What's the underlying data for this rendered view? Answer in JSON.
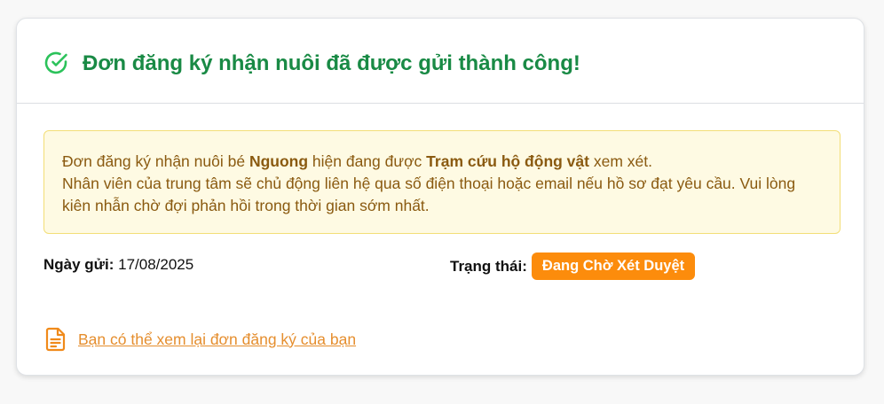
{
  "header": {
    "title": "Đơn đăng ký nhận nuôi đã được gửi thành công!",
    "icon": "check-circle-icon",
    "accent_color": "#198a45"
  },
  "notice": {
    "line1_prefix": "Đơn đăng ký nhận nuôi bé ",
    "pet_name": "Nguong",
    "line1_middle": " hiện đang được ",
    "center_name": "Trạm cứu hộ động vật",
    "line1_suffix": " xem xét.",
    "line2": "Nhân viên của trung tâm sẽ chủ động liên hệ qua số điện thoại hoặc email nếu hồ sơ đạt yêu cầu. Vui lòng kiên nhẫn chờ đợi phản hồi trong thời gian sớm nhất.",
    "background_color": "#fefae3",
    "text_color": "#8a5a10"
  },
  "meta": {
    "date_label": "Ngày gửi:",
    "date_value": "17/08/2025",
    "status_label": "Trạng thái:",
    "status_value": "Đang Chờ Xét Duyệt",
    "status_color": "#fc8c0c"
  },
  "link": {
    "icon": "document-icon",
    "text": "Bạn có thể xem lại đơn đăng ký của bạn",
    "color": "#e58e2e"
  }
}
